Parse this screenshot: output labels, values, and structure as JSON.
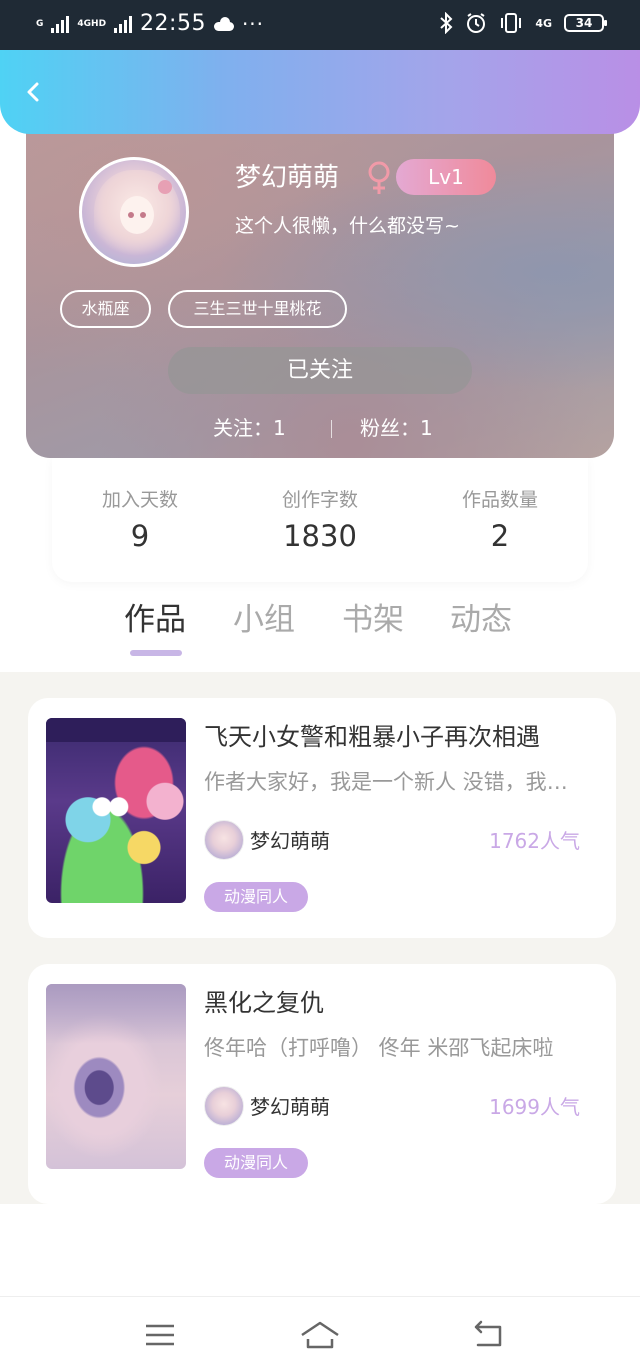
{
  "status_bar": {
    "network_1": "G",
    "network_2": "4GHD",
    "time": "22:55",
    "more": "···",
    "network_3": "4G",
    "battery": "34"
  },
  "profile": {
    "username": "梦幻萌萌",
    "level": "Lv1",
    "bio": "这个人很懒，什么都没写~",
    "tags": [
      "水瓶座",
      "三生三世十里桃花"
    ],
    "follow_button": "已关注",
    "following_label": "关注：1",
    "fans_label": "粉丝：1"
  },
  "stats": [
    {
      "label": "加入天数",
      "value": "9"
    },
    {
      "label": "创作字数",
      "value": "1830"
    },
    {
      "label": "作品数量",
      "value": "2"
    }
  ],
  "tabs": [
    "作品",
    "小组",
    "书架",
    "动态"
  ],
  "active_tab": "作品",
  "works": [
    {
      "title": "飞天小女警和粗暴小子再次相遇",
      "description": "作者大家好，我是一个新人 没错，我是一个新人",
      "author": "梦幻萌萌",
      "popularity": "1762人气",
      "genre": "动漫同人"
    },
    {
      "title": "黑化之复仇",
      "description": "佟年哈（打呼噜） 佟年 米邵飞起床啦",
      "author": "梦幻萌萌",
      "popularity": "1699人气",
      "genre": "动漫同人"
    }
  ],
  "icons": {
    "back": "chevron-left-icon",
    "gender": "female-icon",
    "bluetooth": "bluetooth-icon",
    "alarm": "alarm-icon",
    "vibrate": "vibrate-icon",
    "nav_menu": "menu-icon",
    "nav_home": "home-icon",
    "nav_back": "back-icon"
  },
  "colors": {
    "header_gradient_start": "#4fd2f4",
    "header_gradient_end": "#b98fe6",
    "level_badge": "#f08a9a",
    "gender": "#f19aa8",
    "accent_purple": "#c9a8e6",
    "tab_underline": "#c8b6e6"
  }
}
